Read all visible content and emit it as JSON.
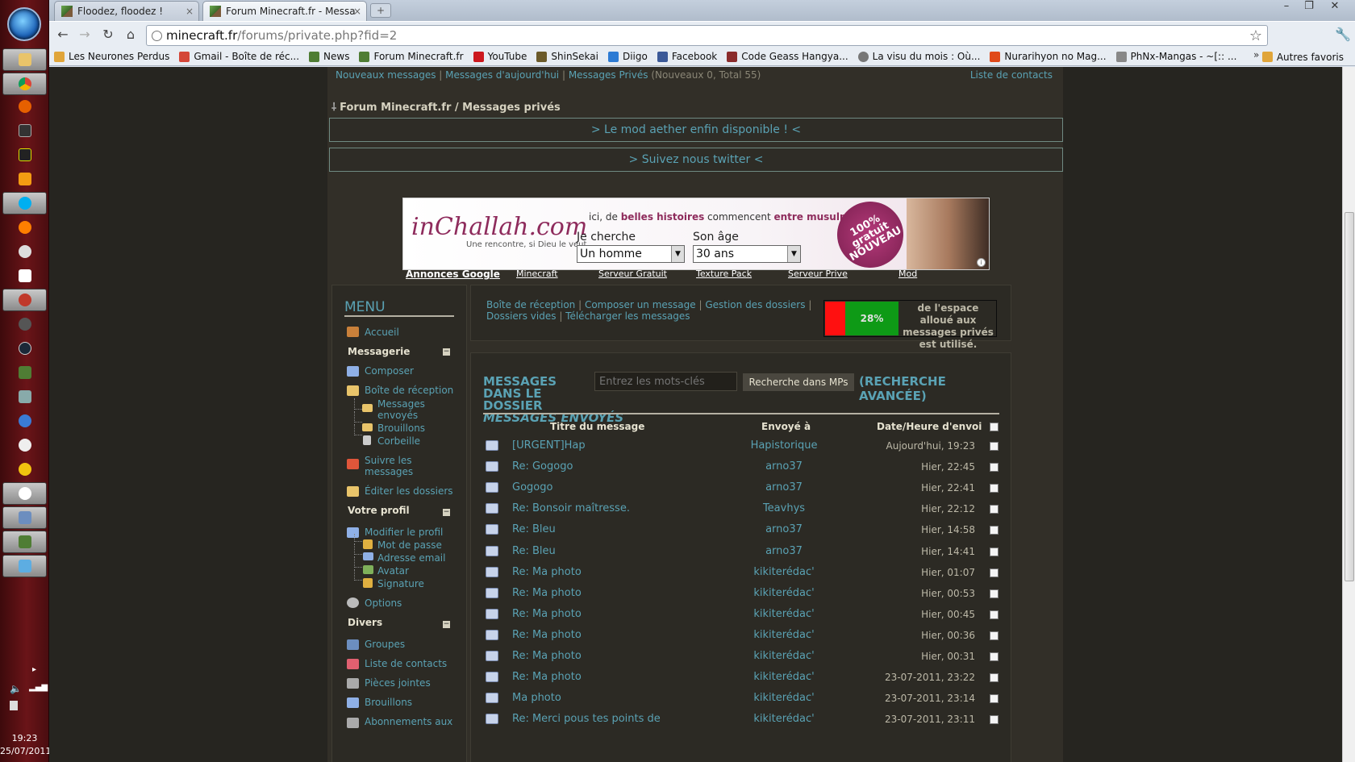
{
  "taskbar": {
    "clock_time": "19:23",
    "clock_date": "25/07/2011"
  },
  "browser": {
    "tabs": [
      {
        "title": "Floodez, floodez !",
        "close": "×"
      },
      {
        "title": "Forum Minecraft.fr - Messa",
        "close": "×"
      }
    ],
    "new_tab": "+",
    "window_controls": [
      "–",
      "❐",
      "✕"
    ],
    "nav": {
      "back": "←",
      "forward": "→",
      "reload": "↻",
      "home": "⌂"
    },
    "url_host": "minecraft.fr",
    "url_path": "/forums/private.php?fid=2",
    "star": "☆",
    "wrench": "🔧",
    "bookmarks": [
      {
        "label": "Les Neurones Perdus",
        "color": "#e0a53a"
      },
      {
        "label": "Gmail - Boîte de réc...",
        "color": "#d44638"
      },
      {
        "label": "News",
        "color": "#4f7d34"
      },
      {
        "label": "Forum Minecraft.fr",
        "color": "#4f7d34"
      },
      {
        "label": "YouTube",
        "color": "#cc181e"
      },
      {
        "label": "ShinSekai",
        "color": "#6b5a2a"
      },
      {
        "label": "Diigo",
        "color": "#2d7bd4"
      },
      {
        "label": "Facebook",
        "color": "#3b5998"
      },
      {
        "label": "Code Geass Hangya...",
        "color": "#8a2b2b"
      },
      {
        "label": "La visu du mois : Où...",
        "color": "#777777"
      },
      {
        "label": "Nurarihyon no Mag...",
        "color": "#e04a1a"
      },
      {
        "label": "PhNx-Mangas - ~[:: ...",
        "color": "#888888"
      }
    ],
    "bookmarks_more": "»",
    "other_bookmarks": "Autres favoris"
  },
  "forum": {
    "topnav": {
      "new_messages": "Nouveaux messages",
      "today_messages": "Messages d'aujourd'hui",
      "private_messages": "Messages Privés",
      "pm_counts": "(Nouveaux 0, Total 55)",
      "contacts": "Liste de contacts"
    },
    "breadcrumb": "Forum Minecraft.fr / Messages privés",
    "banners": [
      "> Le mod aether enfin disponible ! <",
      "> Suivez nous twitter <"
    ],
    "ad": {
      "logo": "inChallah.com",
      "logo_sub": "Une rencontre, si Dieu le veut",
      "tagline_pre": "ici, de ",
      "tagline_bold1": "belles histoires",
      "tagline_mid": " commencent ",
      "tagline_bold2": "entre musulmans",
      "label1": "Je cherche",
      "select1": "Un homme",
      "label2": "Son âge",
      "select2": "30 ans",
      "seal": "100% gratuit NOUVEAU",
      "info": "i"
    },
    "ad_links": [
      "Annonces Google",
      "Minecraft",
      "Serveur Gratuit",
      "Texture Pack",
      "Serveur Prive",
      "Mod"
    ],
    "menu": {
      "title": "MENU",
      "home": "Accueil",
      "sections": [
        {
          "title": "Messagerie",
          "collapse": "−"
        },
        {
          "title": "Votre profil",
          "collapse": "−"
        },
        {
          "title": "Divers",
          "collapse": "−"
        }
      ],
      "messaging": {
        "compose": "Composer",
        "inbox": "Boîte de réception",
        "sent": "Messages envoyés",
        "drafts": "Brouillons",
        "trash": "Corbeille",
        "track": "Suivre les messages",
        "edit_folders": "Éditer les dossiers"
      },
      "profile": {
        "edit": "Modifier le profil",
        "password": "Mot de passe",
        "email": "Adresse email",
        "avatar": "Avatar",
        "signature": "Signature",
        "options": "Options"
      },
      "misc": {
        "groups": "Groupes",
        "contacts": "Liste de contacts",
        "attachments": "Pièces jointes",
        "drafts": "Brouillons",
        "subscriptions": "Abonnements aux"
      }
    },
    "pm_actions": {
      "inbox": "Boîte de réception",
      "compose": "Composer un message",
      "folders": "Gestion des dossiers",
      "empty": "Dossiers vides",
      "download": "Télécharger les messages"
    },
    "quota": {
      "percent_label": "28%",
      "used_fraction": 0.28,
      "text": "de l'espace alloué aux messages privés est utilisé."
    },
    "messages": {
      "heading": "MESSAGES DANS LE DOSSIER",
      "folder": "MESSAGES ENVOYÉS",
      "search_placeholder": "Entrez les mots-clés",
      "search_button": "Recherche dans MPs",
      "advanced": "(RECHERCHE AVANCÉE)",
      "columns": {
        "title": "Titre du message",
        "to": "Envoyé à",
        "date": "Date/Heure d'envoi"
      },
      "rows": [
        {
          "subject": "[URGENT]Hap",
          "to": "Hapistorique",
          "date": "Aujourd'hui, 19:23"
        },
        {
          "subject": "Re: Gogogo",
          "to": "arno37",
          "date": "Hier, 22:45"
        },
        {
          "subject": "Gogogo",
          "to": "arno37",
          "date": "Hier, 22:41"
        },
        {
          "subject": "Re: Bonsoir maîtresse.",
          "to": "Teavhys",
          "date": "Hier, 22:12"
        },
        {
          "subject": "Re: Bleu",
          "to": "arno37",
          "date": "Hier, 14:58"
        },
        {
          "subject": "Re: Bleu",
          "to": "arno37",
          "date": "Hier, 14:41"
        },
        {
          "subject": "Re: Ma photo",
          "to": "kikiterédac'",
          "date": "Hier, 01:07"
        },
        {
          "subject": "Re: Ma photo",
          "to": "kikiterédac'",
          "date": "Hier, 00:53"
        },
        {
          "subject": "Re: Ma photo",
          "to": "kikiterédac'",
          "date": "Hier, 00:45"
        },
        {
          "subject": "Re: Ma photo",
          "to": "kikiterédac'",
          "date": "Hier, 00:36"
        },
        {
          "subject": "Re: Ma photo",
          "to": "kikiterédac'",
          "date": "Hier, 00:31"
        },
        {
          "subject": "Re: Ma photo",
          "to": "kikiterédac'",
          "date": "23-07-2011, 23:22"
        },
        {
          "subject": "Ma photo",
          "to": "kikiterédac'",
          "date": "23-07-2011, 23:14"
        },
        {
          "subject": "Re: Merci pous tes points de",
          "to": "kikiterédac'",
          "date": "23-07-2011, 23:11"
        }
      ]
    }
  }
}
